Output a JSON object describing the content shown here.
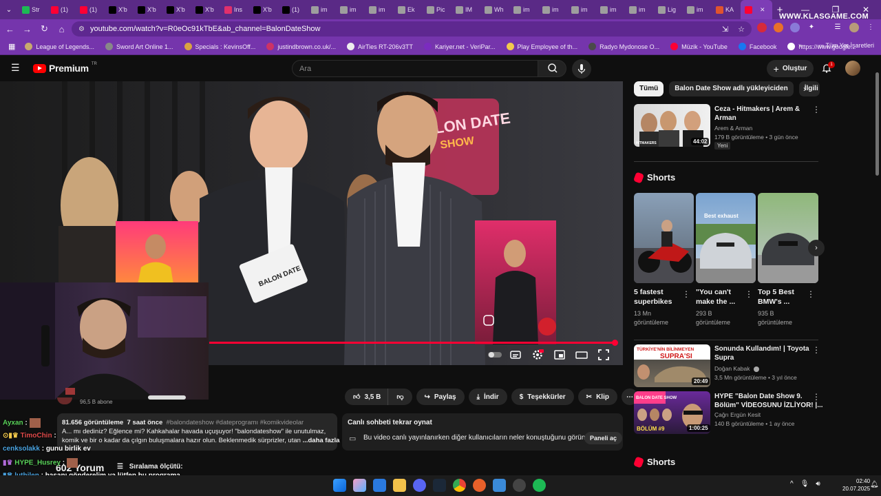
{
  "browser": {
    "tabs": [
      {
        "label": "Str",
        "color": "#1db954"
      },
      {
        "label": "(1)",
        "color": "#ff0033"
      },
      {
        "label": "(1)",
        "color": "#ff0033"
      },
      {
        "label": "X'b",
        "color": "#000000"
      },
      {
        "label": "X'b",
        "color": "#000000"
      },
      {
        "label": "X'b",
        "color": "#000000"
      },
      {
        "label": "X'b",
        "color": "#000000"
      },
      {
        "label": "Ins",
        "color": "#e1306c"
      },
      {
        "label": "X'b",
        "color": "#000000"
      },
      {
        "label": "(1)",
        "color": "#000000"
      },
      {
        "label": "im",
        "color": "#9e9e9e"
      },
      {
        "label": "im",
        "color": "#9e9e9e"
      },
      {
        "label": "im",
        "color": "#9e9e9e"
      },
      {
        "label": "Ek",
        "color": "#9e9e9e"
      },
      {
        "label": "Pic",
        "color": "#9e9e9e"
      },
      {
        "label": "IM",
        "color": "#9e9e9e"
      },
      {
        "label": "Wh",
        "color": "#9e9e9e"
      },
      {
        "label": "im",
        "color": "#9e9e9e"
      },
      {
        "label": "im",
        "color": "#9e9e9e"
      },
      {
        "label": "im",
        "color": "#9e9e9e"
      },
      {
        "label": "im",
        "color": "#9e9e9e"
      },
      {
        "label": "im",
        "color": "#9e9e9e"
      },
      {
        "label": "Lig",
        "color": "#9e9e9e"
      },
      {
        "label": "im",
        "color": "#9e9e9e"
      },
      {
        "label": "KA",
        "color": "#e0542e"
      }
    ],
    "watermark": "WWW.KLASGAME.COM",
    "url": "youtube.com/watch?v=R0eOc91kTbE&ab_channel=BalonDateShow",
    "bookmarks": [
      {
        "label": "League of Legends...",
        "color": "#c8aa6e"
      },
      {
        "label": "Sword Art Online 1...",
        "color": "#888888"
      },
      {
        "label": "Specials : KevinsOff...",
        "color": "#d9a441"
      },
      {
        "label": "justindbrown.co.uk/...",
        "color": "#cc3366"
      },
      {
        "label": "AirTies RT-206v3TT",
        "color": "#eeeeee"
      },
      {
        "label": "Kariyer.net - VeriPar...",
        "color": "#7b2cbf"
      },
      {
        "label": "Play Employee of th...",
        "color": "#f2c94c"
      },
      {
        "label": "Radyo Mydonose O...",
        "color": "#4a4a4a"
      },
      {
        "label": "Müzik - YouTube",
        "color": "#ff0033"
      },
      {
        "label": "Facebook",
        "color": "#1877f2"
      },
      {
        "label": "https://www.google...",
        "color": "#ffffff"
      }
    ],
    "all_bookmarks": "Tüm Yer İşaretleri"
  },
  "youtube": {
    "logo_text": "Premium",
    "logo_region": "TR",
    "search_placeholder": "Ara",
    "create_label": "Oluştur",
    "notification_count": "1"
  },
  "actions": {
    "likes": "3,5 B",
    "share": "Paylaş",
    "download": "İndir",
    "thanks": "Teşekkürler",
    "clip": "Klip"
  },
  "channel": {
    "subscribers": "96,5 B abone"
  },
  "description": {
    "views": "81.656 görüntüleme",
    "age": "7 saat önce",
    "tags": "#balondateshow #dateprogramı #komikvideolar",
    "line1": "A... mı dediniz? Eğlence mi? Kahkahalar havada uçuşuyor! \"balondateshow\" ile unutulmaz,",
    "line2": "komik ve bir o kadar da çılgın buluşmalara hazır olun. Beklenmedik sürprizler, utan",
    "more": "...daha fazla"
  },
  "live_chat": {
    "title": "Canlı sohbeti tekrar oynat",
    "text": "Bu video canlı yayınlanırken diğer kullanıcıların neler konuştuğunu görün.",
    "button": "Paneli aç"
  },
  "comments": {
    "count": "602 Yorum",
    "sort": "Sıralama ölçütü:"
  },
  "stream_chat": [
    {
      "user": "Ayxan",
      "msg": "",
      "color": "#5ad45a"
    },
    {
      "user": "TimoChin",
      "msg": "",
      "color": "#e04a4a"
    },
    {
      "user": "cenksolakk",
      "msg": "gunu birlik ev",
      "color": "#4aa3e0"
    },
    {
      "user": "HYPE_Husrey",
      "msg": "",
      "color": "#5ad45a"
    },
    {
      "user": "luthilen",
      "msg": "hasanı gönderelim ya lütfen bu programa",
      "color": "#4aa3e0"
    }
  ],
  "chips": [
    "Tümü",
    "Balon Date Show adlı yükleyiciden",
    "İlgili"
  ],
  "recommended": [
    {
      "title1": "Ceza - Hitmakers | Arem &",
      "title2": "Arman",
      "channel": "Arem & Arman",
      "meta": "179 B görüntüleme • 3 gün önce",
      "duration": "44:02",
      "badge": "Yeni"
    },
    {
      "title1": "Sonunda Kullandım! | Toyota",
      "title2": "Supra",
      "channel": "Doğan Kabak",
      "meta": "3,5 Mn görüntüleme • 3 yıl önce",
      "duration": "20:49"
    },
    {
      "title1": "HYPE \"Balon Date Show 9.",
      "title2": "Bölüm\" VİDEOSUNU İZLİYOR! |...",
      "channel": "Çağrı Ergün Kesit",
      "meta": "140 B görüntüleme • 1 ay önce",
      "duration": "1:00:25"
    }
  ],
  "shorts_heading": "Shorts",
  "shorts": [
    {
      "title1": "5 fastest",
      "title2": "superbikes",
      "views1": "13 Mn",
      "views2": "görüntüleme"
    },
    {
      "title1": "\"You can't",
      "title2": "make the ...",
      "views1": "293 B",
      "views2": "görüntüleme"
    },
    {
      "title1": "Top 5 Best",
      "title2": "BMW's ...",
      "views1": "935 B",
      "views2": "görüntüleme"
    }
  ],
  "thumb_text": {
    "hitmakers": "HITMAKERS",
    "supra": "TÜRKİYE'NİN BİLİNMEYEN",
    "supra2": "SUPRA'SI",
    "balon": "BALON DATE SHOW",
    "balon2": "BÖLÜM #9",
    "exhaust": "Best exhaust"
  },
  "taskbar": {
    "time": "02:40",
    "date": "20.07.2025"
  }
}
